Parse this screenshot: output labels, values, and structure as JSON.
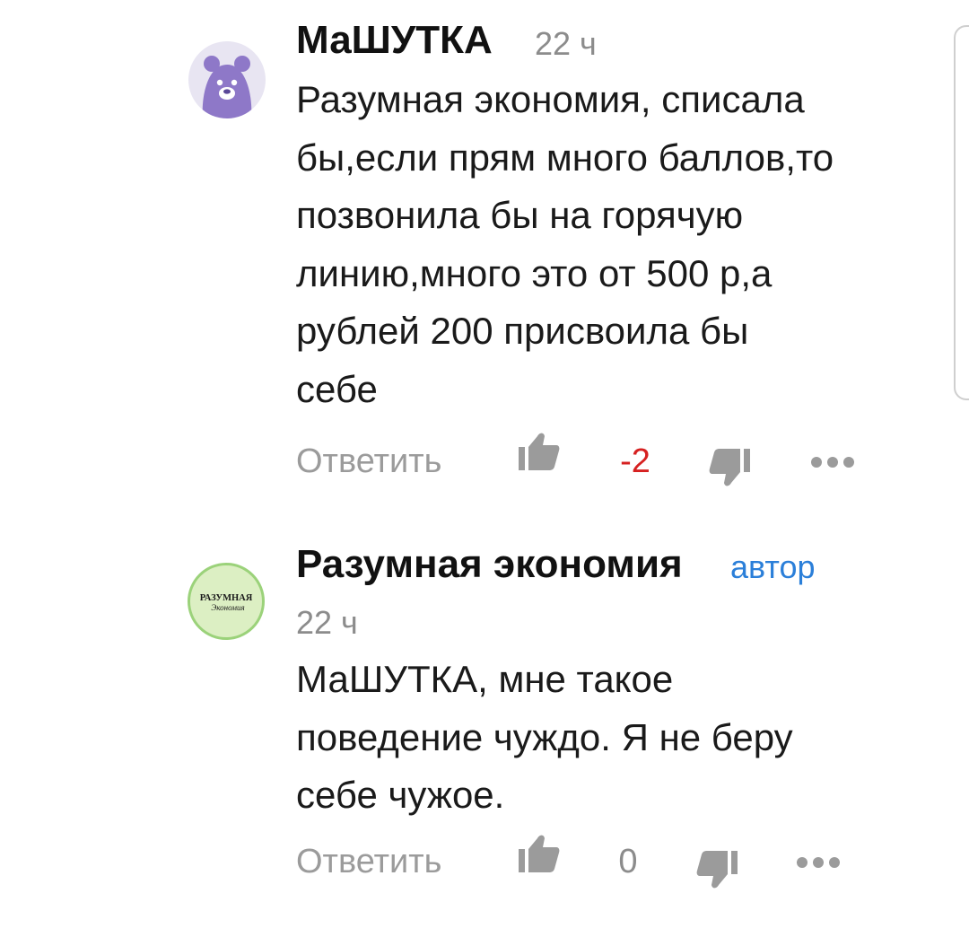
{
  "comments": [
    {
      "author": "МаШУТКА",
      "time": "22 ч",
      "text": "Разумная экономия, списала бы,если прям много баллов,то позвонила бы на горячую линию,много это от 500 р,а рублей 200 присвоила бы себе",
      "text_lines": [
        "Разумная экономия, списала",
        "бы,если прям много баллов,то",
        "позвонила бы на горячую",
        "линию,много это от 500 р,а",
        "рублей 200 присвоила бы",
        "себе"
      ],
      "reply_label": "Ответить",
      "score": "-2",
      "avatar_icon": "bear-avatar-icon"
    },
    {
      "author": "Разумная экономия",
      "author_tag": "автор",
      "time": "22 ч",
      "text": "МаШУТКА, мне такое поведение чуждо. Я не беру себе чужое.",
      "text_lines": [
        "МаШУТКА, мне такое",
        "поведение чуждо. Я не беру",
        "себе чужое."
      ],
      "reply_label": "Ответить",
      "score": "0",
      "avatar_logo": {
        "line1": "РАЗУМНАЯ",
        "line2": "Экономия"
      }
    }
  ],
  "colors": {
    "score_negative": "#d62020",
    "author_tag": "#2b7fd9",
    "muted": "#9b9b9b",
    "bear_avatar": "#8e78c8"
  },
  "icons": {
    "like": "thumbs-up-icon",
    "dislike": "thumbs-down-icon",
    "more": "more-dots-icon"
  }
}
